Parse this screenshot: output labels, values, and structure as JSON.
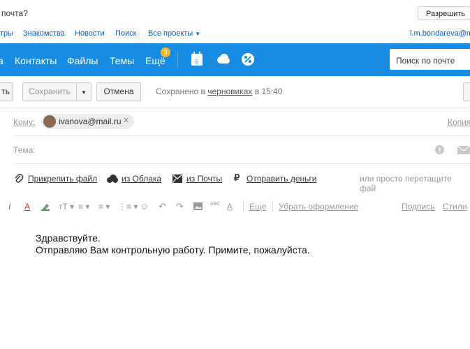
{
  "notification": {
    "text": "почта?",
    "allow_label": "Разрешить"
  },
  "portal": {
    "links": [
      "тры",
      "Знакомства",
      "Новости",
      "Поиск",
      "Все проекты"
    ],
    "user_email": "i.m.bondareva@m"
  },
  "nav": {
    "items": [
      "а",
      "Контакты",
      "Файлы",
      "Темы",
      "Ещё"
    ],
    "badge_count": "3",
    "calendar_day": "6",
    "search_placeholder": "Поиск по почте"
  },
  "toolbar": {
    "send_label": "ть",
    "save_label": "Сохранить",
    "cancel_label": "Отмена",
    "saved_prefix": "Сохранено в",
    "saved_link": "черновиках",
    "saved_time": "в 15:40"
  },
  "compose": {
    "to_label": "Кому:",
    "recipient": "ivanova@mail.ru",
    "copy_label": "Копия",
    "subject_label": "Тема:"
  },
  "attach": {
    "attach_file": "Прикрепить файл",
    "from_cloud": "из Облака",
    "from_mail": "из Почты",
    "send_money": "Отправить деньги",
    "drag_hint": "или просто перетащите фай"
  },
  "format": {
    "more": "Еще",
    "clear": "Убрать оформление",
    "signature": "Подпись",
    "styles": "Стили"
  },
  "body": {
    "line1": "Здравствуйте.",
    "line2": "Отправляю Вам контрольную работу. Примите, пожалуйста."
  },
  "colors": {
    "nav_bg": "#168de2",
    "link": "#005bd1",
    "badge": "#f5b52c"
  }
}
